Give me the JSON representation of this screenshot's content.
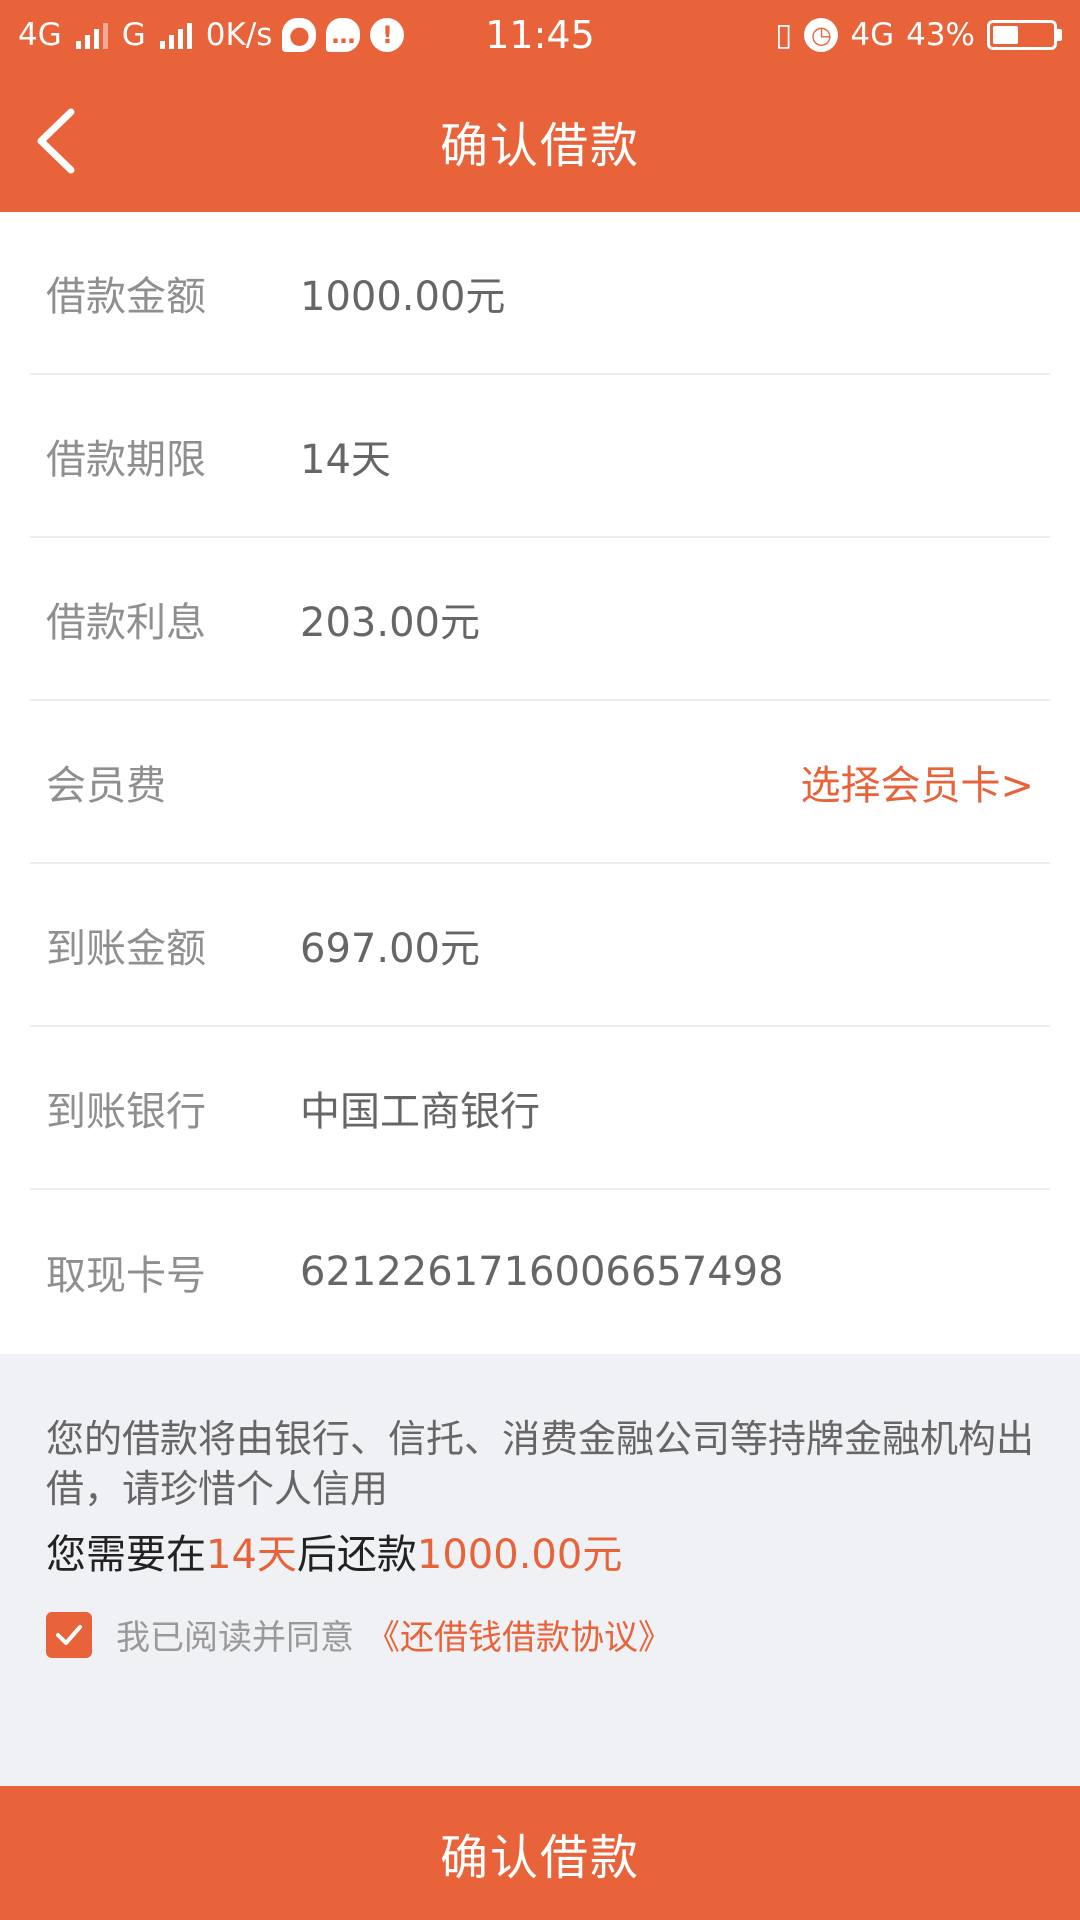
{
  "status_bar": {
    "network1": "4G",
    "network2": "G",
    "speed": "0K/s",
    "time": "11:45",
    "network3": "4G",
    "battery": "43%",
    "battery_level": 0.43
  },
  "header": {
    "title": "确认借款"
  },
  "rows": [
    {
      "label": "借款金额",
      "value": "1000.00元"
    },
    {
      "label": "借款期限",
      "value": "14天"
    },
    {
      "label": "借款利息",
      "value": "203.00元"
    },
    {
      "label": "会员费",
      "action": "选择会员卡>"
    },
    {
      "label": "到账金额",
      "value": "697.00元"
    },
    {
      "label": "到账银行",
      "value": "中国工商银行"
    },
    {
      "label": "取现卡号",
      "value": "6212261716006657498"
    }
  ],
  "notice": {
    "text": "您的借款将由银行、信托、消费金融公司等持牌金融机构出借，请珍惜个人信用",
    "repay_prefix": "您需要在",
    "repay_days": "14天",
    "repay_middle": "后还款",
    "repay_amount": "1000.00元",
    "agree_text": "我已阅读并同意",
    "agree_link": "《还借钱借款协议》",
    "agree_checked": true
  },
  "confirm_button": {
    "label": "确认借款"
  },
  "colors": {
    "accent": "#e8623a",
    "background": "#f0f1f5"
  }
}
